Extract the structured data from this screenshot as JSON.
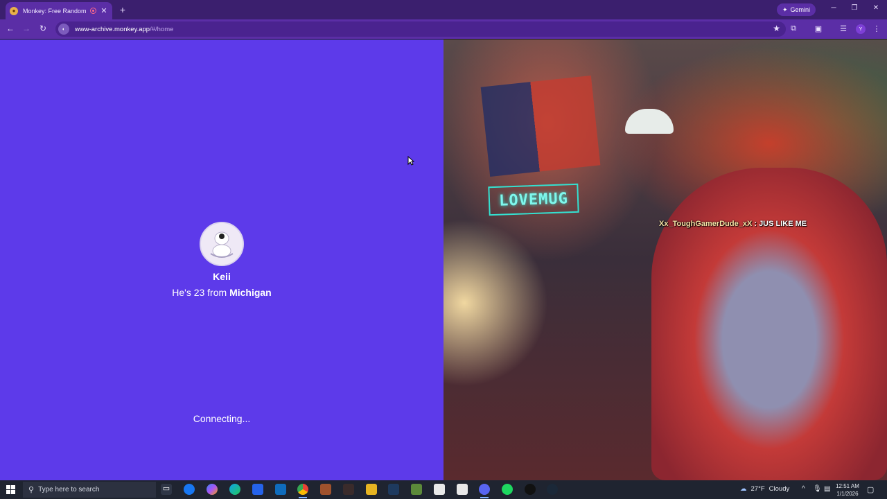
{
  "browser": {
    "tab_title": "Monkey: Free Random Vide",
    "new_tab": "+",
    "tab_close": "✕",
    "gemini_label": "Gemini",
    "url_host": "www-archive.monkey.app",
    "url_path": "/#/home",
    "profile_initial": "Y"
  },
  "page": {
    "user_name": "Keii",
    "info_prefix": "He's 23 from ",
    "location": "Michigan",
    "status": "Connecting...",
    "chat_user": "Xx_ToughGamerDude_xX",
    "chat_separator": " : ",
    "chat_text": "JUS LIKE ME"
  },
  "taskbar": {
    "search_placeholder": "Type here to search",
    "temperature": "27°F",
    "weather": "Cloudy",
    "time": "12:51 AM",
    "date": "1/1/2026"
  },
  "colors": {
    "page_bg": "#5d3aea",
    "browser_frame": "#5b2ea6",
    "chat_user": "#f6e3a6"
  },
  "icons": [
    "back-icon",
    "forward-icon",
    "reload-icon",
    "star-icon",
    "extensions-icon",
    "search-icon",
    "windows-start-icon"
  ]
}
